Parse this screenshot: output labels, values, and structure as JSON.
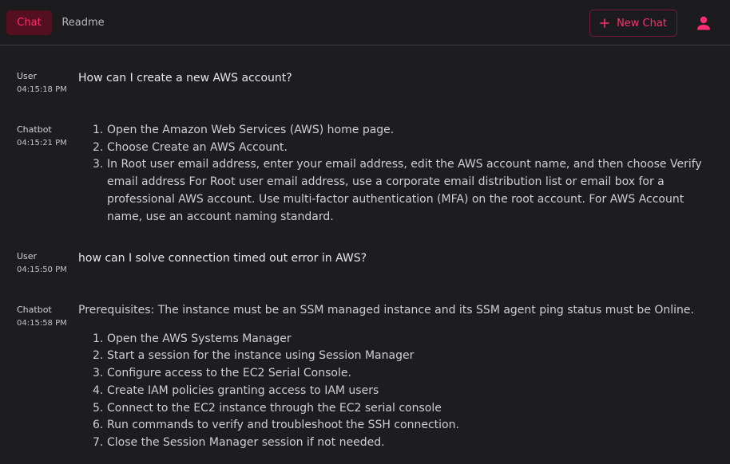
{
  "header": {
    "tabs": [
      {
        "label": "Chat",
        "active": true
      },
      {
        "label": "Readme",
        "active": false
      }
    ],
    "new_chat_label": "New Chat",
    "accent_color": "#ff2e74"
  },
  "messages": [
    {
      "role": "User",
      "time": "04:15:18 PM",
      "text": "How can I create a new AWS account?"
    },
    {
      "role": "Chatbot",
      "time": "04:15:21 PM",
      "steps": [
        "Open the Amazon Web Services (AWS) home page.",
        "Choose Create an AWS Account.",
        "In Root user email address, enter your email address, edit the AWS account name, and then choose Verify email address For Root user email address, use a corporate email distribution list or email box for a professional AWS account. Use multi-factor authentication (MFA) on the root account. For AWS Account name, use an account naming standard."
      ]
    },
    {
      "role": "User",
      "time": "04:15:50 PM",
      "text": "how can I solve connection timed out error in AWS?"
    },
    {
      "role": "Chatbot",
      "time": "04:15:58 PM",
      "intro": "Prerequisites: The instance must be an SSM managed instance and its SSM agent ping status must be Online.",
      "steps": [
        "Open the AWS Systems Manager",
        "Start a session for the instance using Session Manager",
        "Configure access to the EC2 Serial Console.",
        "Create IAM policies granting access to IAM users",
        "Connect to the EC2 instance through the EC2 serial console",
        "Run commands to verify and troubleshoot the SSH connection.",
        "Close the Session Manager session if not needed."
      ]
    }
  ]
}
